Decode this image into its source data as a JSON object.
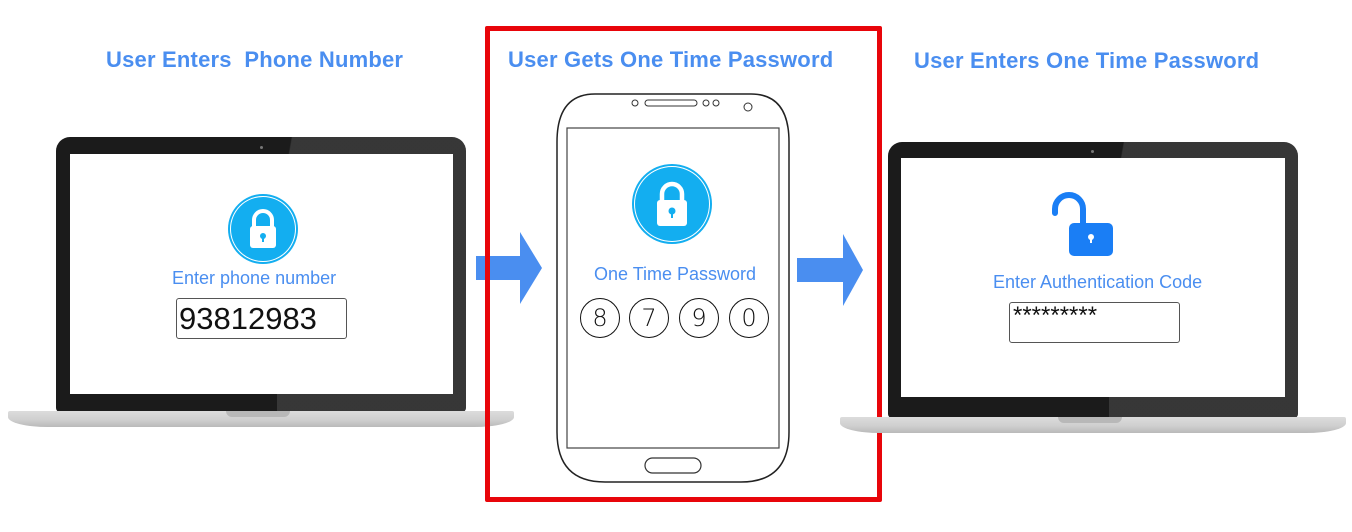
{
  "steps": [
    {
      "heading": "User Enters  Phone Number",
      "device": "laptop",
      "icon": "lock-closed-icon",
      "prompt": "Enter phone number",
      "input_value": "93812983"
    },
    {
      "heading": "User Gets One Time Password",
      "device": "smartphone",
      "icon": "lock-closed-icon",
      "prompt": "One Time Password",
      "otp_digits": [
        "8",
        "7",
        "9",
        "0"
      ],
      "highlighted": true
    },
    {
      "heading": "User Enters One Time Password",
      "device": "laptop",
      "icon": "lock-open-icon",
      "prompt": "Enter Authentication Code",
      "input_value": "*********"
    }
  ],
  "arrows": [
    "arrow-right-icon",
    "arrow-right-icon"
  ],
  "colors": {
    "heading": "#4a8ef0",
    "lock_circle": "#13aef0",
    "unlock": "#1a7ef5",
    "arrow": "#4a8ef0",
    "highlight_frame": "#e8050a"
  }
}
